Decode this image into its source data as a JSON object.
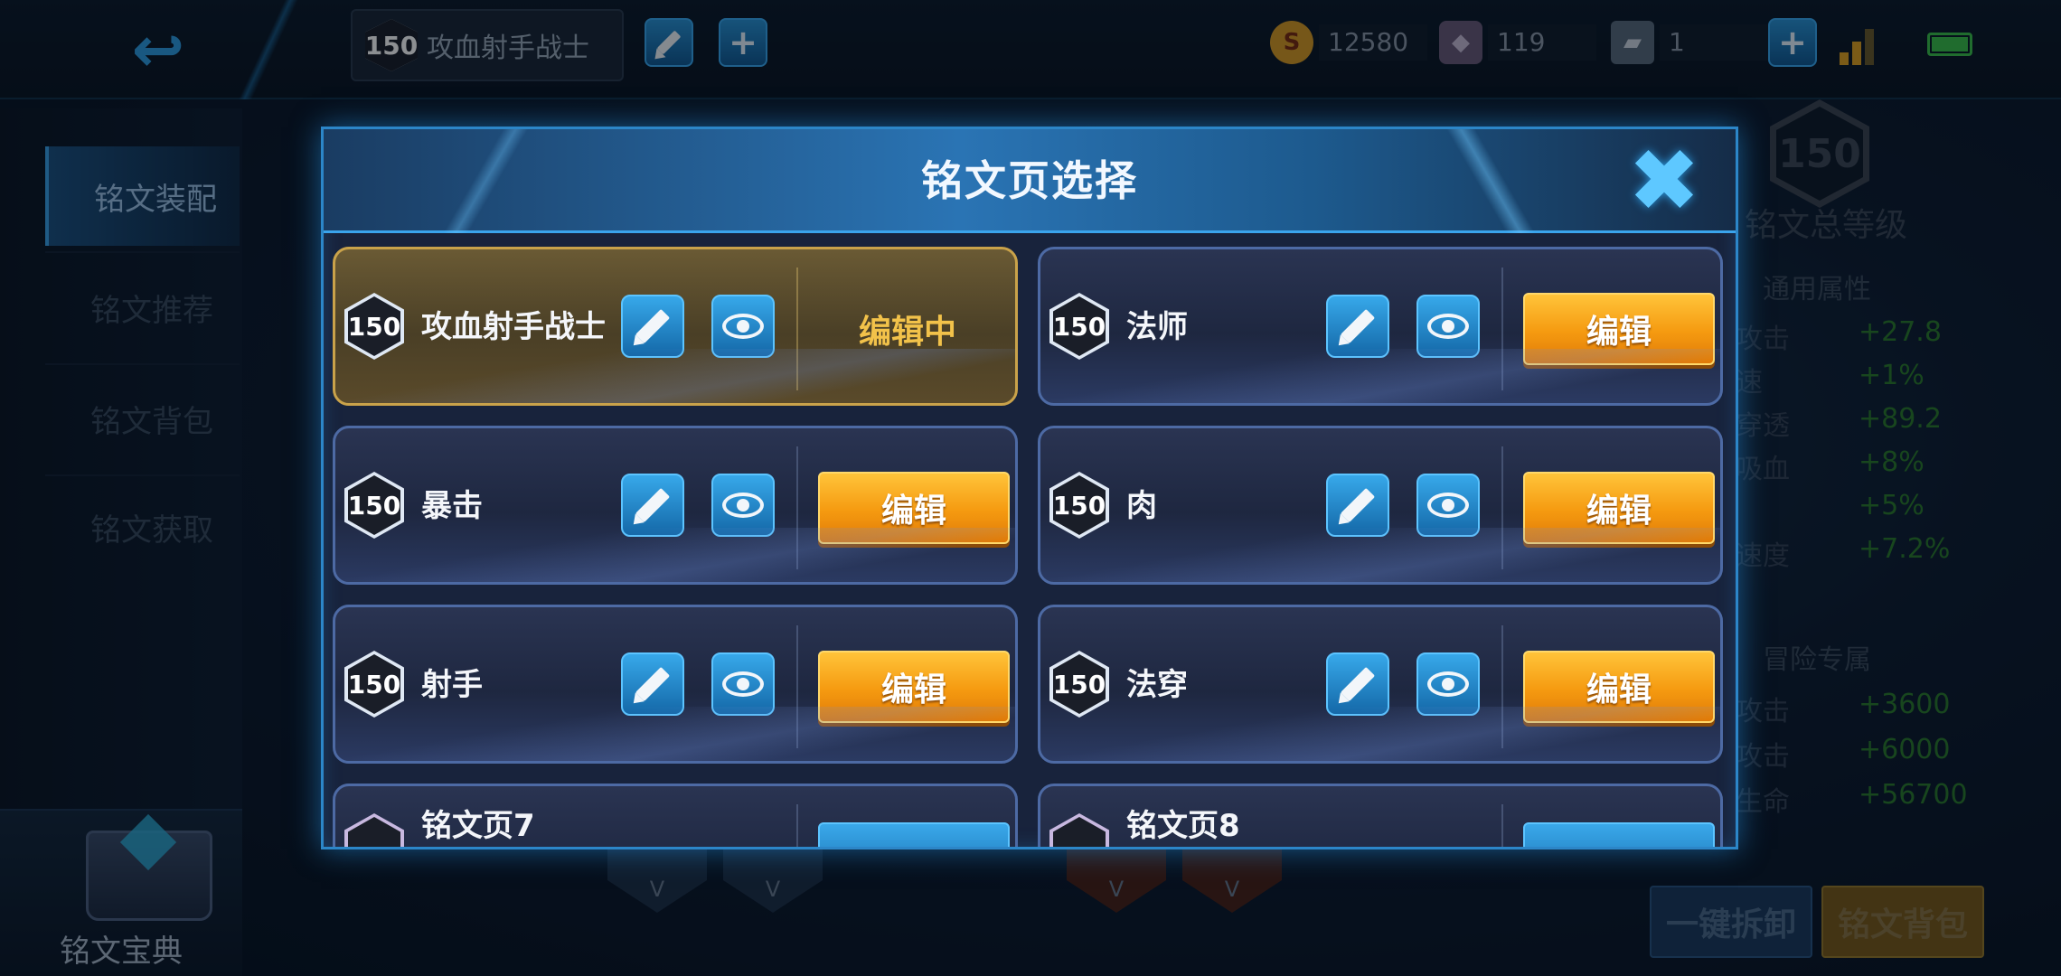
{
  "topbar": {
    "current_page": {
      "level": "150",
      "name": "攻血射手战士"
    },
    "currencies": [
      {
        "icon": "gold-coin-icon",
        "value": "12580"
      },
      {
        "icon": "diamond-icon",
        "value": "119"
      },
      {
        "icon": "voucher-icon",
        "value": "1"
      }
    ]
  },
  "sidebar": {
    "items": [
      {
        "label": "铭文装配"
      },
      {
        "label": "铭文推荐"
      },
      {
        "label": "铭文背包"
      },
      {
        "label": "铭文获取"
      }
    ],
    "codex_label": "铭文宝典"
  },
  "right_panel": {
    "level": "150",
    "title": "铭文总等级",
    "general_section": "通用属性",
    "general_stats": [
      {
        "key": "攻击",
        "value": "+27.8"
      },
      {
        "key": "速",
        "value": "+1%"
      },
      {
        "key": "穿透",
        "value": "+89.2"
      },
      {
        "key": "吸血",
        "value": "+8%"
      },
      {
        "key": "",
        "value": "+5%"
      },
      {
        "key": "速度",
        "value": "+7.2%"
      }
    ],
    "adventure_section": "冒险专属",
    "adventure_stats": [
      {
        "key": "攻击",
        "value": "+3600"
      },
      {
        "key": "攻击",
        "value": "+6000"
      },
      {
        "key": "生命",
        "value": "+56700"
      }
    ],
    "unequip_all": "一键拆卸",
    "bag_button": "铭文背包"
  },
  "modal": {
    "title": "铭文页选择",
    "edit_label": "编辑",
    "editing_label": "编辑中",
    "pages": [
      {
        "level": "150",
        "name": "攻血射手战士",
        "active": true
      },
      {
        "level": "150",
        "name": "法师",
        "active": false
      },
      {
        "level": "150",
        "name": "暴击",
        "active": false
      },
      {
        "level": "150",
        "name": "肉",
        "active": false
      },
      {
        "level": "150",
        "name": "射手",
        "active": false
      },
      {
        "level": "150",
        "name": "法穿",
        "active": false
      },
      {
        "level": "",
        "name": "铭文页7",
        "active": false
      },
      {
        "level": "",
        "name": "铭文页8",
        "active": false
      }
    ]
  },
  "colors": {
    "accent_blue": "#2c86c8",
    "button_orange": "#f59a10",
    "active_gold": "#c9a24a",
    "stat_green": "#2c7a2c"
  }
}
